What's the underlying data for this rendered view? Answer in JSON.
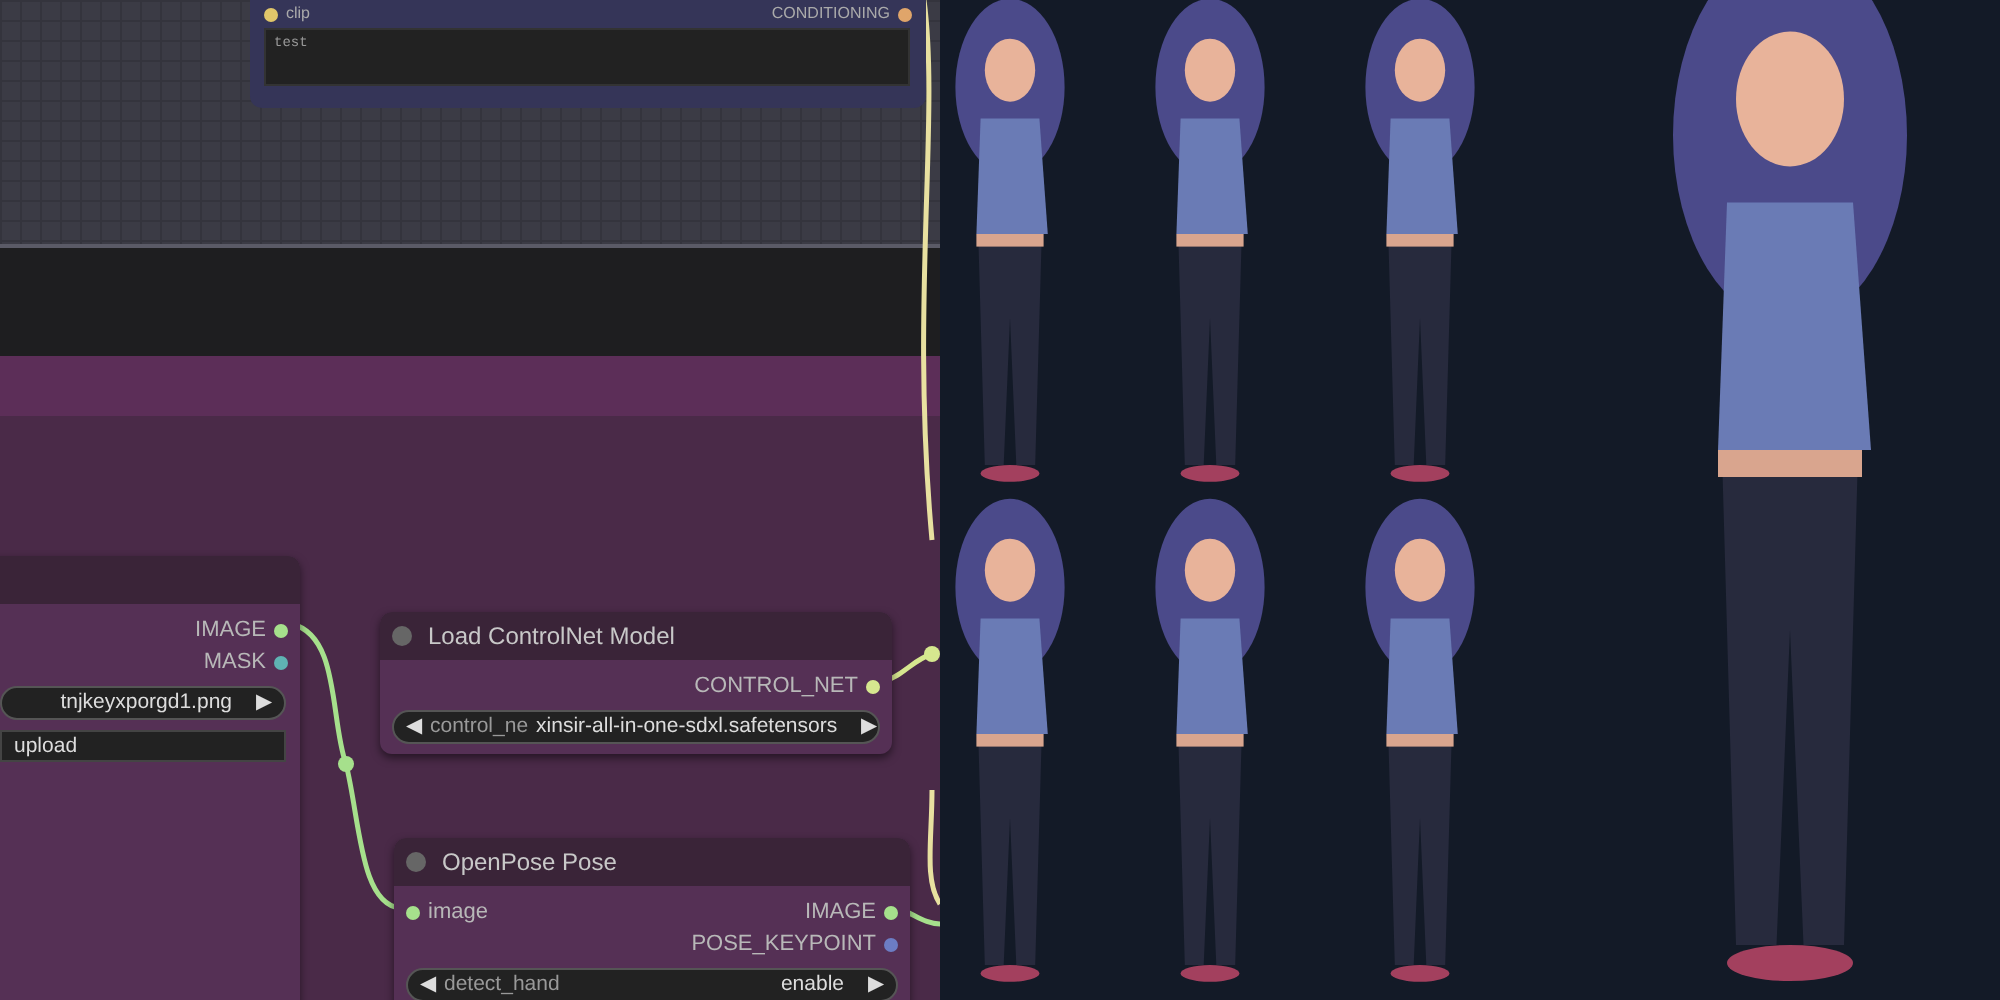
{
  "text_node": {
    "input": {
      "label": "clip",
      "color": "#e0c66a"
    },
    "output": {
      "label": "CONDITIONING",
      "color": "#e0a56a"
    },
    "text": "test"
  },
  "nodes": [
    {
      "kind": "load_image",
      "outputs": [
        {
          "label": "IMAGE",
          "color": "#a6e08c"
        },
        {
          "label": "MASK",
          "color": "#5fb3b3"
        }
      ],
      "widget": {
        "value": "tnjkeyxporgd1.png",
        "right_arrow": "▶"
      },
      "button": "upload"
    },
    {
      "kind": "controlnet",
      "title": "Load ControlNet Model",
      "outputs": [
        {
          "label": "CONTROL_NET",
          "color": "#d6e78f"
        }
      ],
      "widget": {
        "label": "control_ne",
        "value": "xinsir-all-in-one-sdxl.safetensors",
        "left_arrow": "◀",
        "right_arrow": "▶"
      }
    },
    {
      "kind": "openpose",
      "title": "OpenPose Pose",
      "inputs": [
        {
          "label": "image",
          "color": "#a6e08c"
        }
      ],
      "outputs": [
        {
          "label": "IMAGE",
          "color": "#a6e08c"
        },
        {
          "label": "POSE_KEYPOINT",
          "color": "#6c7dc4"
        }
      ],
      "widget": {
        "label": "detect_hand",
        "value": "enable",
        "left_arrow": "◀",
        "right_arrow": "▶"
      }
    }
  ]
}
